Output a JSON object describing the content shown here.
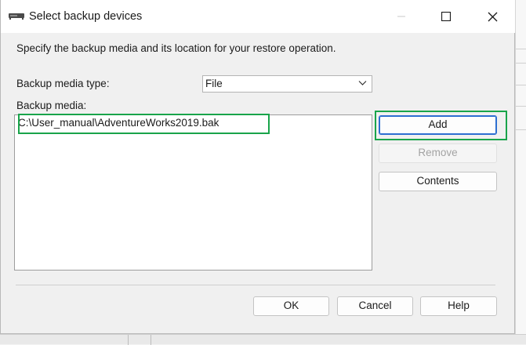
{
  "window": {
    "title": "Select backup devices",
    "icon": "backup-device-icon"
  },
  "description": "Specify the backup media and its location for your restore operation.",
  "media_type": {
    "label": "Backup media type:",
    "value": "File"
  },
  "media": {
    "label": "Backup media:",
    "items": [
      "C:\\User_manual\\AdventureWorks2019.bak"
    ]
  },
  "side_buttons": {
    "add": "Add",
    "remove": "Remove",
    "contents": "Contents"
  },
  "footer_buttons": {
    "ok": "OK",
    "cancel": "Cancel",
    "help": "Help"
  },
  "colors": {
    "highlight": "#19a44a",
    "focus_border": "#2d6fd1"
  }
}
